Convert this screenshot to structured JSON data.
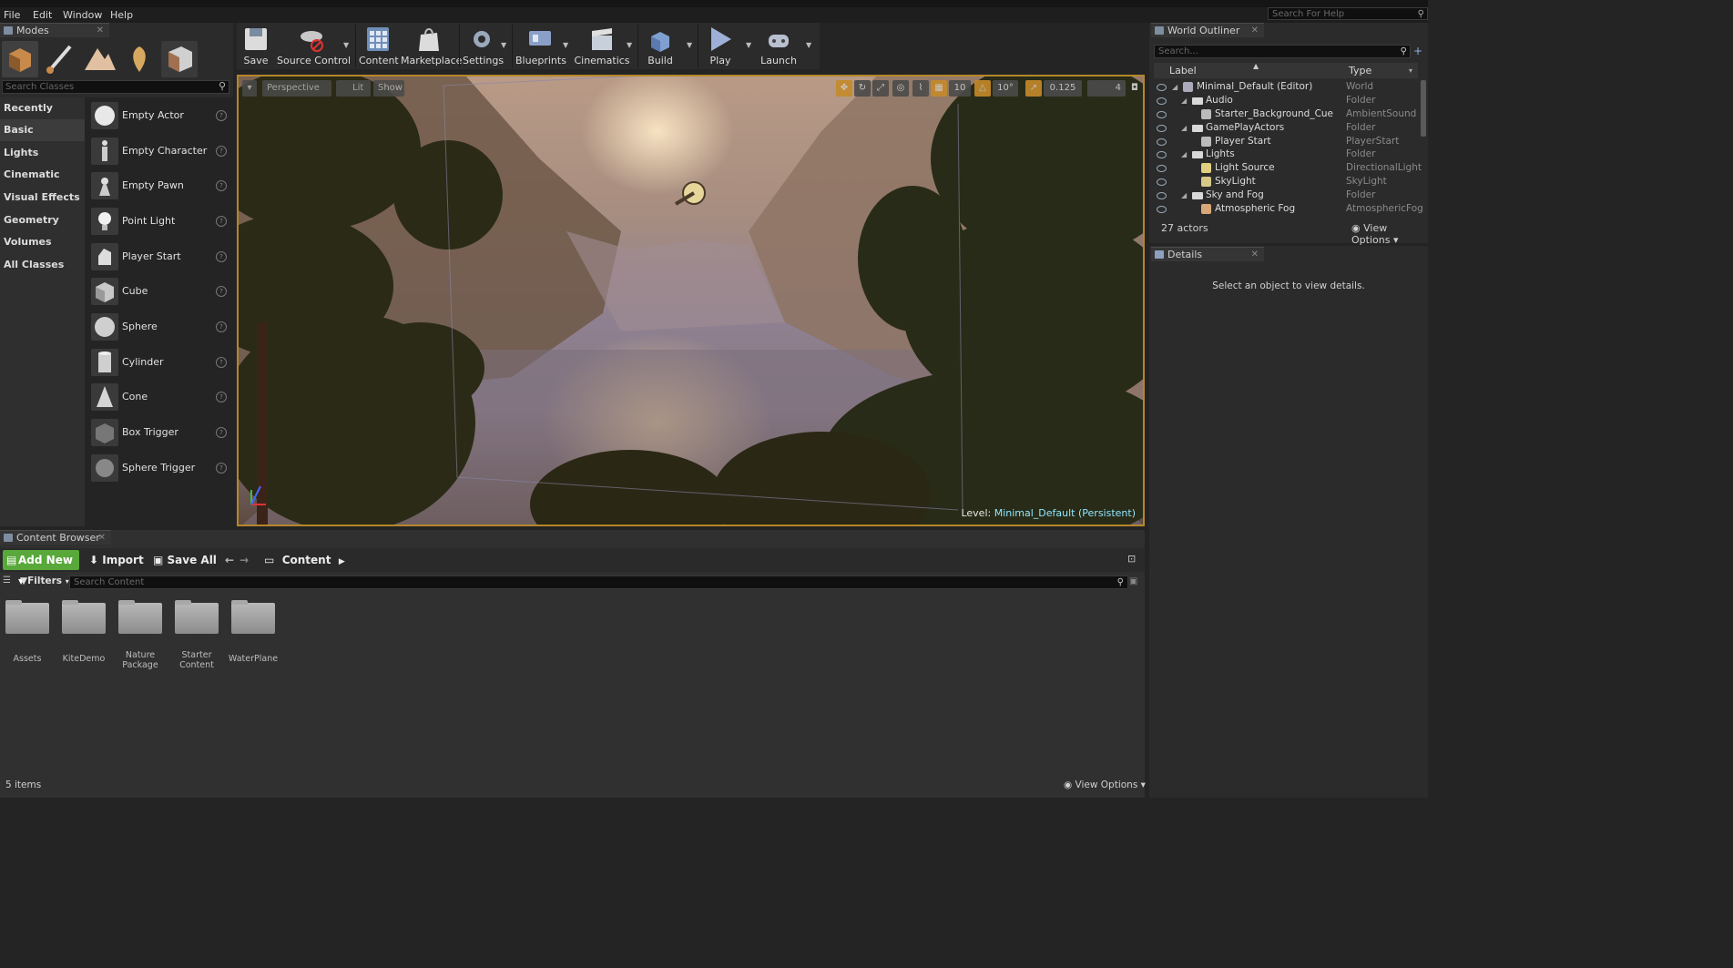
{
  "menu": {
    "items": [
      "File",
      "Edit",
      "Window",
      "Help"
    ],
    "help_search_placeholder": "Search For Help"
  },
  "modes_panel": {
    "title": "Modes",
    "search_placeholder": "Search Classes",
    "categories": [
      "Recently Placed",
      "Basic",
      "Lights",
      "Cinematic",
      "Visual Effects",
      "Geometry",
      "Volumes",
      "All Classes"
    ],
    "selected_category": "Basic",
    "items": [
      "Empty Actor",
      "Empty Character",
      "Empty Pawn",
      "Point Light",
      "Player Start",
      "Cube",
      "Sphere",
      "Cylinder",
      "Cone",
      "Box Trigger",
      "Sphere Trigger"
    ]
  },
  "toolbar": {
    "buttons": [
      "Save",
      "Source Control",
      "Content",
      "Marketplace",
      "Settings",
      "Blueprints",
      "Cinematics",
      "Build",
      "Play",
      "Launch"
    ]
  },
  "viewport": {
    "perspective_label": "Perspective",
    "lit_label": "Lit",
    "show_label": "Show",
    "grid_snap": "10",
    "rotation_snap": "10°",
    "scale_snap": "0.125",
    "camera_speed": "4",
    "level_prefix": "Level:",
    "level_name": "Minimal_Default (Persistent)"
  },
  "outliner": {
    "title": "World Outliner",
    "search_placeholder": "Search...",
    "col_label": "Label",
    "col_type": "Type",
    "rows": [
      {
        "label": "Minimal_Default (Editor)",
        "type": "World"
      },
      {
        "label": "Audio",
        "type": "Folder"
      },
      {
        "label": "Starter_Background_Cue",
        "type": "AmbientSound"
      },
      {
        "label": "GamePlayActors",
        "type": "Folder"
      },
      {
        "label": "Player Start",
        "type": "PlayerStart"
      },
      {
        "label": "Lights",
        "type": "Folder"
      },
      {
        "label": "Light Source",
        "type": "DirectionalLight"
      },
      {
        "label": "SkyLight",
        "type": "SkyLight"
      },
      {
        "label": "Sky and Fog",
        "type": "Folder"
      },
      {
        "label": "Atmospheric Fog",
        "type": "AtmosphericFog"
      }
    ],
    "actor_count": "27 actors",
    "view_options": "View Options"
  },
  "details": {
    "title": "Details",
    "empty_message": "Select an object to view details."
  },
  "content_browser": {
    "title": "Content Browser",
    "add_new": "Add New",
    "import": "Import",
    "save_all": "Save All",
    "path": "Content",
    "filters": "Filters",
    "search_placeholder": "Search Content",
    "folders": [
      "Assets",
      "KiteDemo",
      "Nature Package",
      "Starter Content",
      "WaterPlane"
    ],
    "item_count": "5 items",
    "view_options": "View Options"
  },
  "colors": {
    "accent_green": "#58a83a",
    "viewport_border": "#b5862a",
    "level_name": "#8fe6ff"
  }
}
